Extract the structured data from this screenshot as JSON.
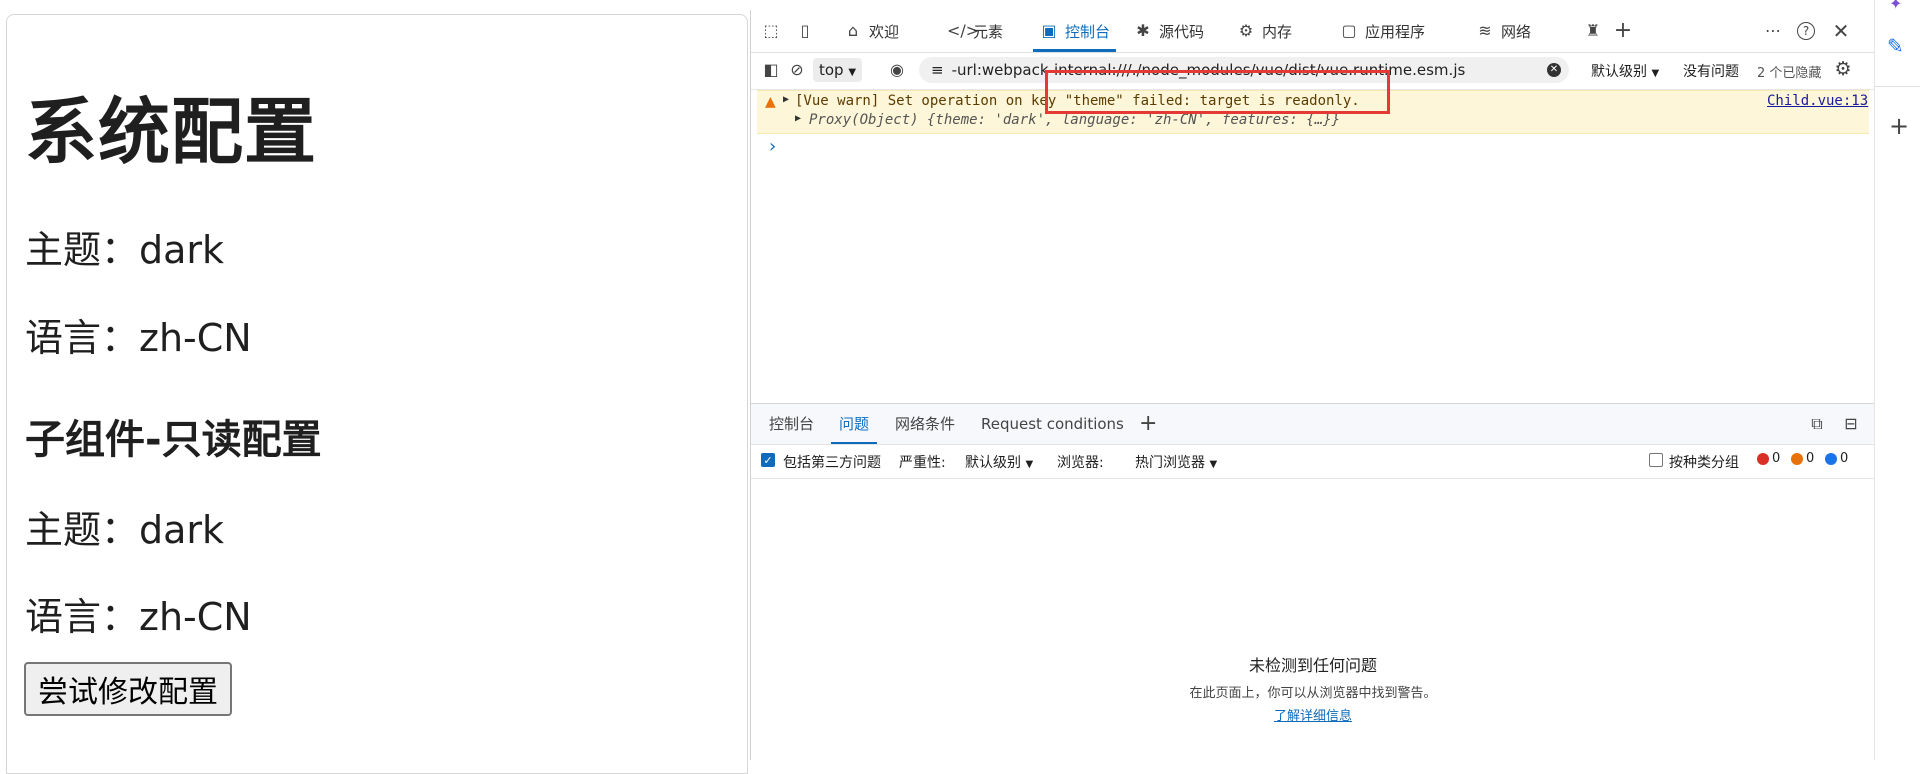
{
  "page": {
    "title": "系统配置",
    "theme_line": "主题：dark",
    "lang_line": "语言：zh-CN",
    "child_title": "子组件-只读配置",
    "child_theme_line": "主题：dark",
    "child_lang_line": "语言：zh-CN",
    "button_label": "尝试修改配置"
  },
  "devtools": {
    "tabs": [
      {
        "label": "欢迎",
        "icon": "home-icon"
      },
      {
        "label": "元素",
        "icon": "code-icon"
      },
      {
        "label": "控制台",
        "icon": "console-icon"
      },
      {
        "label": "源代码",
        "icon": "bug-icon"
      },
      {
        "label": "内存",
        "icon": "memory-icon"
      },
      {
        "label": "应用程序",
        "icon": "app-icon"
      },
      {
        "label": "网络",
        "icon": "wifi-icon"
      }
    ],
    "toolbar": {
      "context": "top",
      "filter_value": "-url:webpack-internal:///./node_modules/vue/dist/vue.runtime.esm.js",
      "level": "默认级别",
      "no_issues": "没有问题",
      "hidden": "2 个已隐藏"
    },
    "console": {
      "warning_text": "[Vue warn] Set operation on key \"theme\" failed: target is readonly.",
      "warning_source": "Child.vue:13",
      "proxy_line": "Proxy(Object) {theme: 'dark', language: 'zh-CN', features: {…}}",
      "prompt": "›"
    },
    "drawer": {
      "tabs": [
        "控制台",
        "问题",
        "网络条件",
        "Request conditions"
      ],
      "include_third_party": "包括第三方问题",
      "severity_label": "严重性:",
      "severity_value": "默认级别",
      "browser_label": "浏览器:",
      "browser_value": "热门浏览器",
      "group_by_kind": "按种类分组",
      "counts": [
        "0",
        "0",
        "0"
      ],
      "empty_title": "未检测到任何问题",
      "empty_desc": "在此页面上，你可以从浏览器中找到警告。",
      "learn_more": "了解详细信息"
    },
    "colors": {
      "accent": "#0f6cbd",
      "warn_bg": "#fdf6d8",
      "highlight": "#e53935"
    }
  }
}
